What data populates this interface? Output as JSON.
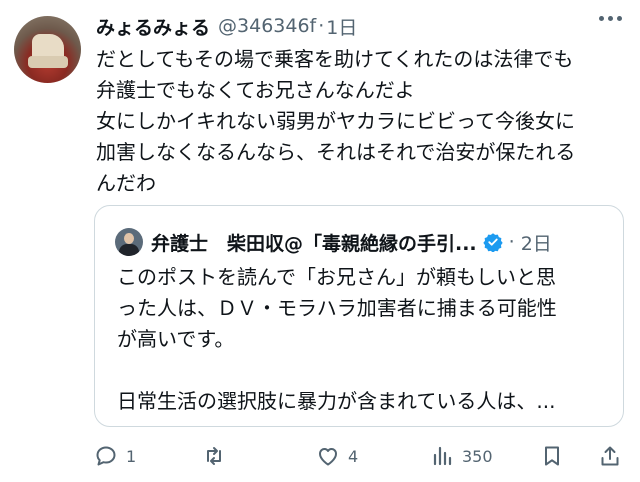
{
  "post": {
    "display_name": "みょるみょる",
    "handle": "@346346f",
    "separator": "·",
    "time": "1日",
    "avatar_icon": "user-avatar",
    "lines": [
      "だとしてもその場で乗客を助けてくれたのは法律でも",
      "弁護士でもなくてお兄さんなんだよ",
      "女にしかイキれない弱男がヤカラにビビって今後女に",
      "加害しなくなるんなら、それはそれで治安が保たれる",
      "んだわ"
    ]
  },
  "quote": {
    "display_name": "弁護士　柴田収@「毒親絶縁の手引...",
    "verified_icon": "verified-badge-icon",
    "separator": "·",
    "time": "2日",
    "lines": [
      "このポストを読んで「お兄さん」が頼もしいと思",
      "った人は、ＤＶ・モラハラ加害者に捕まる可能性",
      "が高いです。",
      "",
      "日常生活の選択肢に暴力が含まれている人は、..."
    ]
  },
  "actions": {
    "reply_count": "1",
    "retweet_count": "",
    "like_count": "4",
    "view_count": "350"
  },
  "colors": {
    "text": "#0f1419",
    "secondary": "#536471",
    "verified": "#1d9bf0",
    "border": "#cfd9de"
  }
}
